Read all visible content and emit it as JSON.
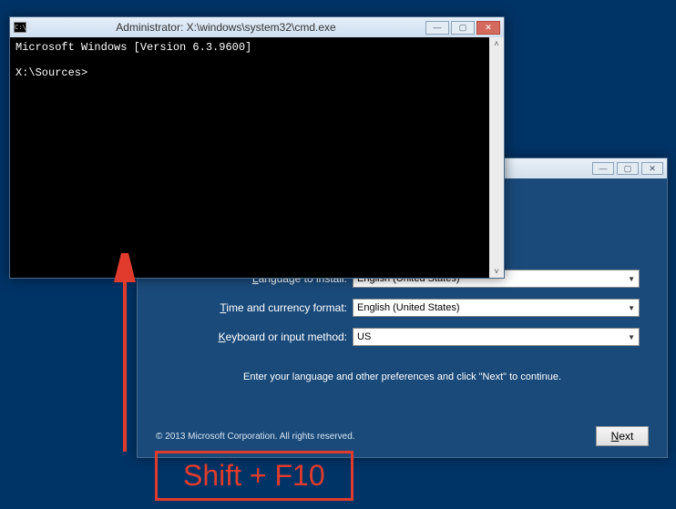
{
  "setup": {
    "labels": {
      "language_pre": "L",
      "language_post": "anguage to install:",
      "time_pre": "T",
      "time_post": "ime and currency format:",
      "keyboard_pre": "K",
      "keyboard_post": "eyboard or input method:"
    },
    "values": {
      "language": "English (United States)",
      "time": "English (United States)",
      "keyboard": "US"
    },
    "hint": "Enter your language and other preferences and click \"Next\" to continue.",
    "copyright": "© 2013 Microsoft Corporation. All rights reserved.",
    "next_pre": "N",
    "next_post": "ext",
    "controls": {
      "min": "—",
      "max": "▢",
      "close": "✕"
    }
  },
  "cmd": {
    "icon_text": "C:\\",
    "title": "Administrator: X:\\windows\\system32\\cmd.exe",
    "line1": "Microsoft Windows [Version 6.3.9600]",
    "line2": "",
    "line3": "X:\\Sources>",
    "controls": {
      "min": "—",
      "max": "▢",
      "close": "✕"
    },
    "scroll_up": "˄",
    "scroll_down": "˅"
  },
  "annotation": {
    "text": "Shift + F10"
  }
}
